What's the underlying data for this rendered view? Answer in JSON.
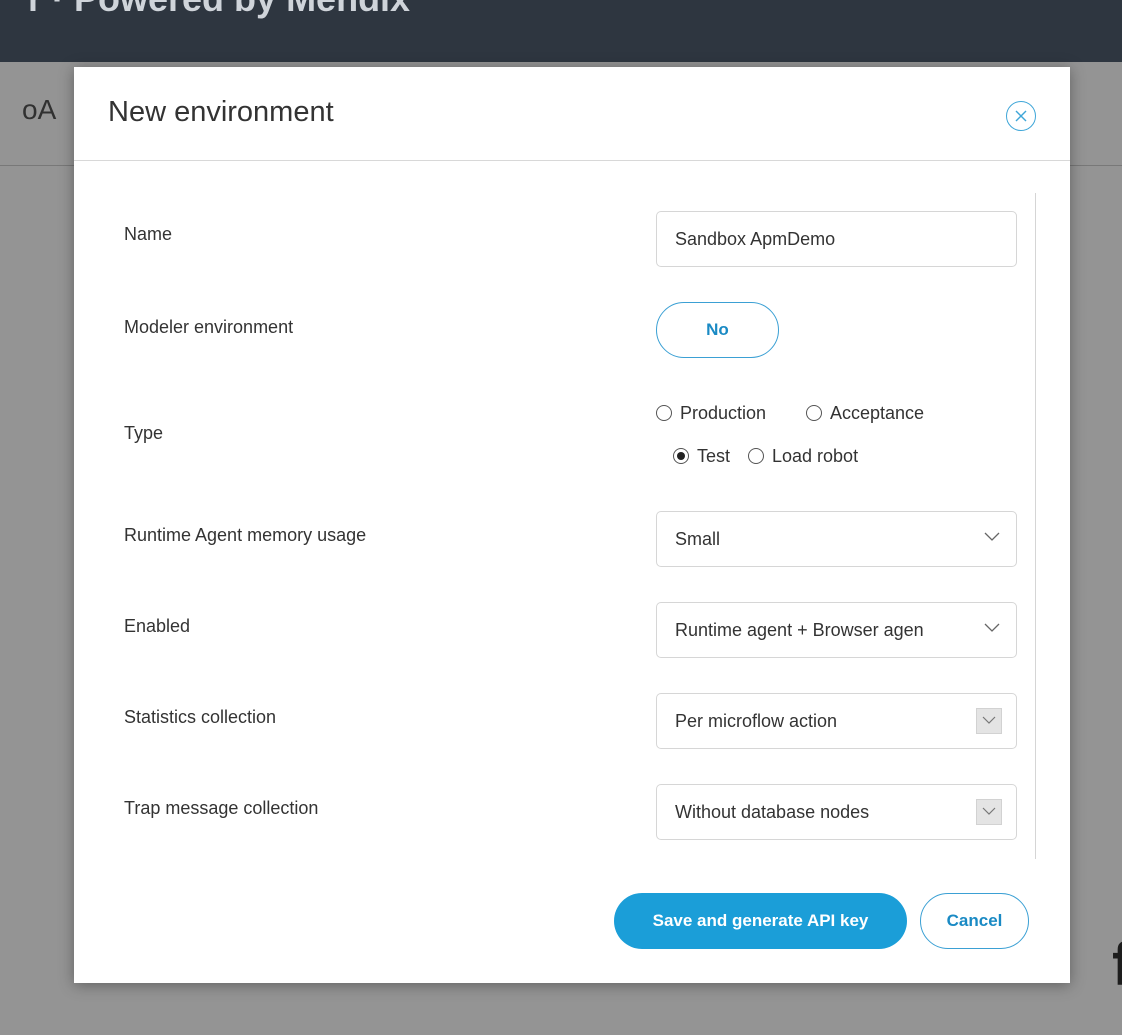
{
  "background": {
    "topbar_text": "r · Powered by Mendix",
    "subtitle_fragment": "oA",
    "edge_glyph": "f"
  },
  "modal": {
    "title": "New environment",
    "close_icon": "close-circle-icon"
  },
  "form": {
    "name": {
      "label": "Name",
      "value": "Sandbox ApmDemo"
    },
    "modeler_environment": {
      "label": "Modeler environment",
      "toggle_label": "No"
    },
    "type": {
      "label": "Type",
      "options": [
        {
          "label": "Production",
          "checked": false
        },
        {
          "label": "Acceptance",
          "checked": false
        },
        {
          "label": "Test",
          "checked": true
        },
        {
          "label": "Load robot",
          "checked": false
        }
      ]
    },
    "memory_usage": {
      "label": "Runtime Agent memory usage",
      "selected": "Small"
    },
    "enabled": {
      "label": "Enabled",
      "selected": "Runtime agent + Browser agen"
    },
    "statistics_collection": {
      "label": "Statistics collection",
      "selected": "Per microflow action"
    },
    "trap_message_collection": {
      "label": "Trap message collection",
      "selected": "Without database nodes"
    }
  },
  "actions": {
    "save_label": "Save and generate API key",
    "cancel_label": "Cancel"
  },
  "colors": {
    "accent": "#1b9ed8",
    "topbar": "#2e3640"
  }
}
